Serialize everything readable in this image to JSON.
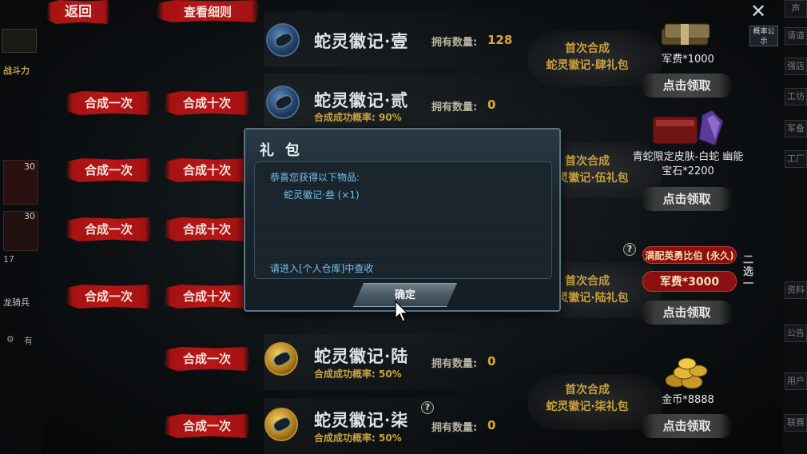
{
  "header": {
    "back_label": "返回",
    "rules_label": "查看细则",
    "rate_tab": "概率公示"
  },
  "left_side": {
    "power_label": "战斗力",
    "name_label": "龙骑兵",
    "number_1": "30",
    "number_2": "30",
    "count_3": "17",
    "side_1": "有"
  },
  "right_side": {
    "tabs": [
      "声",
      "请道",
      "强店",
      "工坊",
      "军备",
      "工厂"
    ],
    "tabs_lower": [
      "资料",
      "公告",
      "用户",
      "联赛"
    ]
  },
  "synth_buttons": {
    "once": "合成一次",
    "ten": "合成十次"
  },
  "items": [
    {
      "name": "蛇灵徽记·壹",
      "own_label": "拥有数量:",
      "own_value": "128",
      "rate": ""
    },
    {
      "name": "蛇灵徽记·贰",
      "own_label": "拥有数量:",
      "own_value": "0",
      "rate": "合成成功概率: 90%"
    },
    {
      "name": "蛇灵徽记·陆",
      "own_label": "拥有数量:",
      "own_value": "0",
      "rate": "合成成功概率: 50%"
    },
    {
      "name": "蛇灵徽记·柒",
      "own_label": "拥有数量:",
      "own_value": "0",
      "rate": "合成成功概率: 50%"
    }
  ],
  "covered_item_partial": "蛇灵",
  "rewards": [
    {
      "title_1": "首次合成",
      "title_2": "蛇灵徽记·肆礼包",
      "prize": "军费*1000",
      "claim": "点击领取"
    },
    {
      "title_1": "首次合成",
      "title_2": "蛇灵徽记·伍礼包",
      "prize": "青蛇限定皮肤-白蛇 幽能宝石*2200",
      "claim": "点击领取"
    },
    {
      "title_1": "首次合成",
      "title_2": "蛇灵徽记·陆礼包",
      "option_1": "满配英勇比伯 (永久)",
      "option_2": "军费*3000",
      "choose": "二选一",
      "claim": "点击领取"
    },
    {
      "title_1": "首次合成",
      "title_2": "蛇灵徽记·柒礼包",
      "prize": "金币*8888",
      "claim": "点击领取"
    }
  ],
  "dialog": {
    "title": "礼包",
    "line_1": "恭喜您获得以下物品:",
    "line_2": "蛇灵徽记·叁 (×1)",
    "line_3": "请进入[个人仓库]中查收",
    "ok": "确定"
  },
  "colors": {
    "accent_red": "#b81616",
    "gold": "#d7a93e",
    "dialog_text": "#76c2ee"
  }
}
